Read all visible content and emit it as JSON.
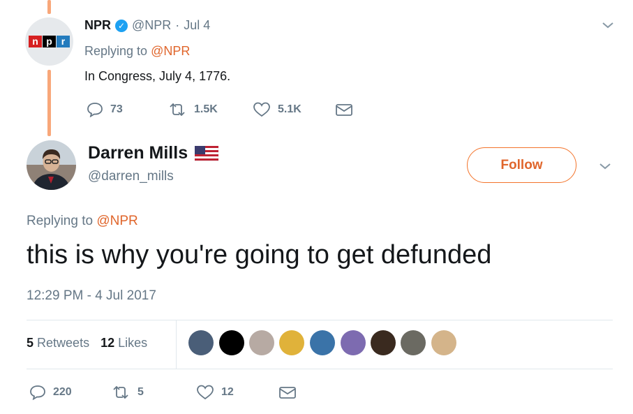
{
  "parent_tweet": {
    "name": "NPR",
    "handle": "@NPR",
    "sep": "·",
    "date": "Jul 4",
    "replying_prefix": "Replying to",
    "replying_to": "@NPR",
    "text": "In Congress, July 4, 1776.",
    "logo": {
      "n": "n",
      "p": "p",
      "r": "r"
    },
    "replies": "73",
    "retweets": "1.5K",
    "likes": "5.1K"
  },
  "reply_tweet": {
    "name": "Darren Mills",
    "flag": "us-flag-icon",
    "handle": "@darren_mills",
    "follow_label": "Follow",
    "replying_prefix": "Replying to",
    "replying_to": "@NPR",
    "text": "this is why you're going to get defunded",
    "timestamp": "12:29 PM - 4 Jul 2017",
    "retweet_count": "5",
    "retweet_label": "Retweets",
    "like_count": "12",
    "like_label": "Likes",
    "replies": "220",
    "retweets": "5",
    "likes": "12"
  },
  "colors": {
    "accent": "#e0662c",
    "thread": "#f8a77a",
    "muted": "#657786",
    "verified": "#1da1f2"
  }
}
